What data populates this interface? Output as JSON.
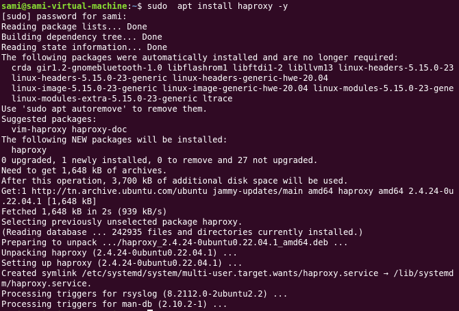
{
  "prompt": {
    "user_host": "sami@sami-virtual-machine",
    "colon": ":",
    "path": "~",
    "dollar": "$",
    "command": " sudo  apt install haproxy -y"
  },
  "output": [
    "[sudo] password for sami:",
    "Reading package lists... Done",
    "Building dependency tree... Done",
    "Reading state information... Done",
    "The following packages were automatically installed and are no longer required:",
    "  crda gir1.2-gnomebluetooth-1.0 libflashrom1 libftdi1-2 libllvm13 linux-headers-5.15.0-23",
    "  linux-headers-5.15.0-23-generic linux-headers-generic-hwe-20.04",
    "  linux-image-5.15.0-23-generic linux-image-generic-hwe-20.04 linux-modules-5.15.0-23-gene",
    "  linux-modules-extra-5.15.0-23-generic ltrace",
    "Use 'sudo apt autoremove' to remove them.",
    "Suggested packages:",
    "  vim-haproxy haproxy-doc",
    "The following NEW packages will be installed:",
    "  haproxy",
    "0 upgraded, 1 newly installed, 0 to remove and 27 not upgraded.",
    "Need to get 1,648 kB of archives.",
    "After this operation, 3,700 kB of additional disk space will be used.",
    "Get:1 http://tn.archive.ubuntu.com/ubuntu jammy-updates/main amd64 haproxy amd64 2.4.24-0u",
    ".22.04.1 [1,648 kB]",
    "Fetched 1,648 kB in 2s (939 kB/s)",
    "Selecting previously unselected package haproxy.",
    "(Reading database ... 242935 files and directories currently installed.)",
    "Preparing to unpack .../haproxy_2.4.24-0ubuntu0.22.04.1_amd64.deb ...",
    "Unpacking haproxy (2.4.24-0ubuntu0.22.04.1) ...",
    "Setting up haproxy (2.4.24-0ubuntu0.22.04.1) ...",
    "Created symlink /etc/systemd/system/multi-user.target.wants/haproxy.service → /lib/systemd",
    "m/haproxy.service.",
    "Processing triggers for rsyslog (8.2112.0-2ubuntu2.2) ...",
    "Processing triggers for man-db (2.10.2-1) ..."
  ],
  "colors": {
    "background": "#300a24",
    "user_host": "#8ae234",
    "path": "#729fcf",
    "text": "#ffffff"
  }
}
